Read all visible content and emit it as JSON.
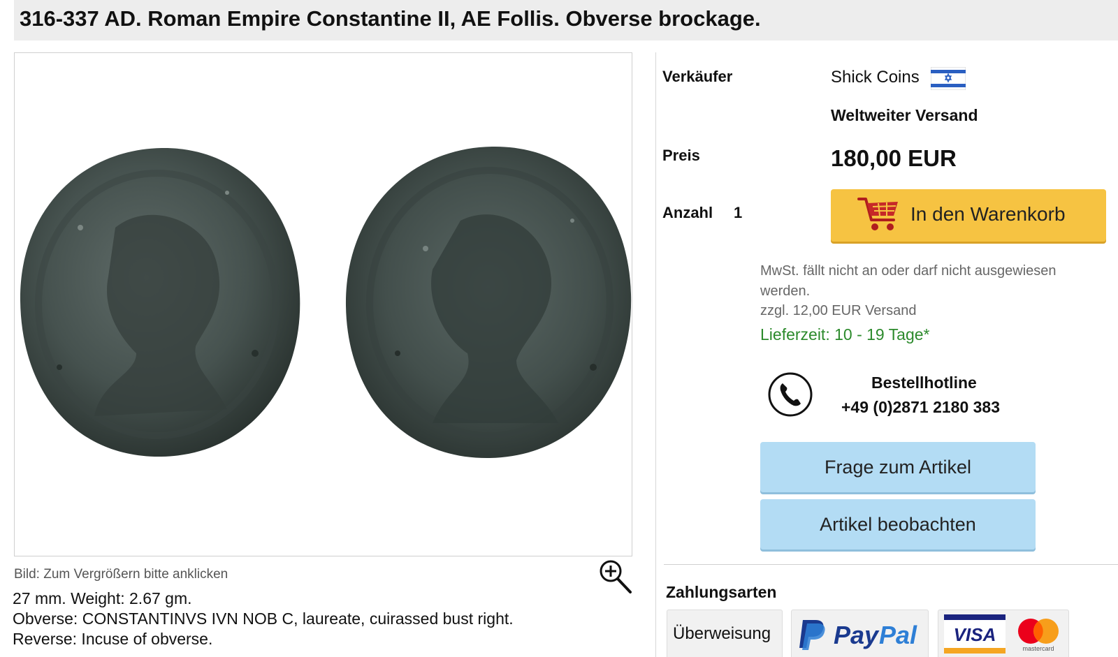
{
  "header": {
    "title": "316-337 AD. Roman Empire Constantine II, AE Follis. Obverse brockage."
  },
  "gallery": {
    "caption": "Bild: Zum Vergrößern bitte anklicken",
    "zoom_icon": "zoom-in-icon"
  },
  "description": {
    "line1": "27 mm. Weight: 2.67 gm.",
    "line2": "Obverse: CONSTANTINVS IVN NOB C, laureate, cuirassed bust right.",
    "line3": "Reverse: Incuse of obverse."
  },
  "seller": {
    "label": "Verkäufer",
    "name": "Shick Coins",
    "flag_icon": "israel-flag-icon",
    "shipping": "Weltweiter Versand"
  },
  "price": {
    "label": "Preis",
    "value": "180,00 EUR"
  },
  "quantity": {
    "label": "Anzahl",
    "value": "1"
  },
  "cart": {
    "label": "In den Warenkorb",
    "icon": "shopping-cart-icon",
    "color": "#f6c342"
  },
  "notes": {
    "vat": "MwSt. fällt nicht an oder darf nicht ausgewiesen werden.",
    "shipping_cost": "zzgl. 12,00 EUR Versand",
    "delivery": "Lieferzeit: 10 - 19 Tage*",
    "delivery_color": "#2c8a2c"
  },
  "hotline": {
    "icon": "phone-icon",
    "label": "Bestellhotline",
    "number": "+49 (0)2871 2180 383"
  },
  "actions": {
    "question": "Frage zum Artikel",
    "watch": "Artikel beobachten",
    "button_color": "#b3dcf4"
  },
  "payment": {
    "title": "Zahlungsarten",
    "methods": [
      {
        "label": "Überweisung",
        "icon": "bank-transfer-icon"
      },
      {
        "label": "PayPal",
        "icon": "paypal-logo"
      },
      {
        "label": "VISA",
        "icon": "visa-logo"
      },
      {
        "label": "mastercard",
        "icon": "mastercard-logo"
      }
    ]
  }
}
